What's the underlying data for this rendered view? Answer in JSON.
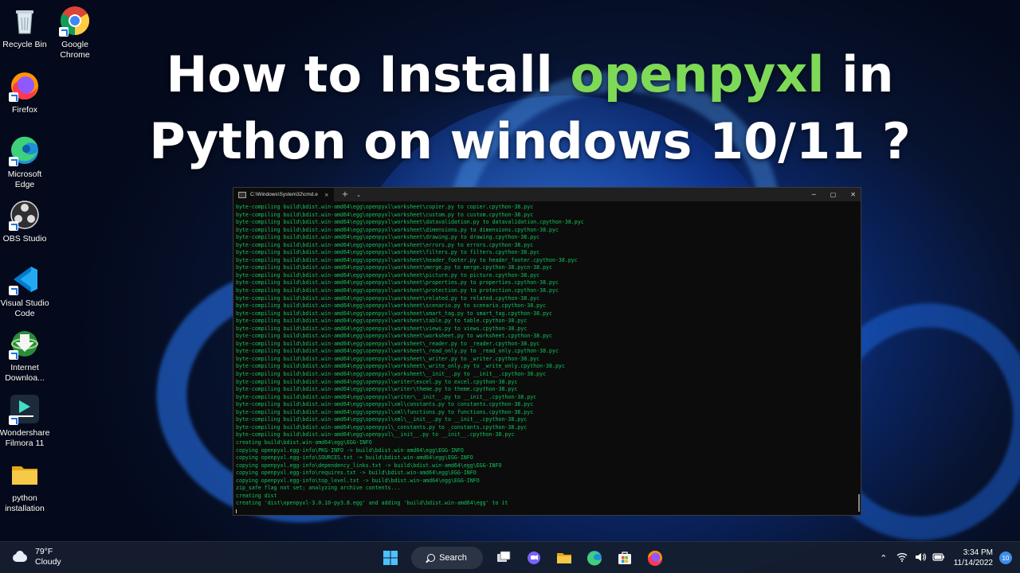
{
  "desktop": {
    "icons": [
      {
        "label": "Recycle Bin",
        "icon": "recycle-bin-icon"
      },
      {
        "label": "Google Chrome",
        "icon": "chrome-icon"
      },
      {
        "label": "Firefox",
        "icon": "firefox-icon"
      },
      {
        "label": "Microsoft Edge",
        "icon": "edge-icon"
      },
      {
        "label": "OBS Studio",
        "icon": "obs-icon"
      },
      {
        "label": "Visual Studio Code",
        "icon": "vscode-icon"
      },
      {
        "label": "Internet Downloa...",
        "icon": "idm-icon"
      },
      {
        "label": "Wondershare Filmora 11",
        "icon": "filmora-icon"
      },
      {
        "label": "python installation",
        "icon": "folder-icon"
      }
    ]
  },
  "headline": {
    "part1": "How to Install ",
    "highlight": "openpyxl",
    "part2": " in",
    "line2": "Python on windows 10/11 ?",
    "highlight_color": "#7ed957"
  },
  "terminal": {
    "tab_title": "C:\\Windows\\System32\\cmd.e",
    "tab_close": "×",
    "new_tab": "+",
    "dropdown": "⌄",
    "minimize": "─",
    "maximize": "▢",
    "close": "✕",
    "text_color": "#13c35a",
    "lines": [
      "byte-compiling build\\bdist.win-amd64\\egg\\openpyxl\\worksheet\\copier.py to copier.cpython-38.pyc",
      "byte-compiling build\\bdist.win-amd64\\egg\\openpyxl\\worksheet\\custom.py to custom.cpython-38.pyc",
      "byte-compiling build\\bdist.win-amd64\\egg\\openpyxl\\worksheet\\datavalidation.py to datavalidation.cpython-38.pyc",
      "byte-compiling build\\bdist.win-amd64\\egg\\openpyxl\\worksheet\\dimensions.py to dimensions.cpython-38.pyc",
      "byte-compiling build\\bdist.win-amd64\\egg\\openpyxl\\worksheet\\drawing.py to drawing.cpython-38.pyc",
      "byte-compiling build\\bdist.win-amd64\\egg\\openpyxl\\worksheet\\errors.py to errors.cpython-38.pyc",
      "byte-compiling build\\bdist.win-amd64\\egg\\openpyxl\\worksheet\\filters.py to filters.cpython-38.pyc",
      "byte-compiling build\\bdist.win-amd64\\egg\\openpyxl\\worksheet\\header_footer.py to header_footer.cpython-38.pyc",
      "byte-compiling build\\bdist.win-amd64\\egg\\openpyxl\\worksheet\\merge.py to merge.cpython-38.pycn-38.pyc",
      "byte-compiling build\\bdist.win-amd64\\egg\\openpyxl\\worksheet\\picture.py to picture.cpython-38.pyc",
      "byte-compiling build\\bdist.win-amd64\\egg\\openpyxl\\worksheet\\properties.py to properties.cpython-38.pyc",
      "byte-compiling build\\bdist.win-amd64\\egg\\openpyxl\\worksheet\\protection.py to protection.cpython-38.pyc",
      "byte-compiling build\\bdist.win-amd64\\egg\\openpyxl\\worksheet\\related.py to related.cpython-38.pyc",
      "byte-compiling build\\bdist.win-amd64\\egg\\openpyxl\\worksheet\\scenario.py to scenario.cpython-38.pyc",
      "byte-compiling build\\bdist.win-amd64\\egg\\openpyxl\\worksheet\\smart_tag.py to smart_tag.cpython-38.pyc",
      "byte-compiling build\\bdist.win-amd64\\egg\\openpyxl\\worksheet\\table.py to table.cpython-38.pyc",
      "byte-compiling build\\bdist.win-amd64\\egg\\openpyxl\\worksheet\\views.py to views.cpython-38.pyc",
      "byte-compiling build\\bdist.win-amd64\\egg\\openpyxl\\worksheet\\worksheet.py to worksheet.cpython-38.pyc",
      "byte-compiling build\\bdist.win-amd64\\egg\\openpyxl\\worksheet\\_reader.py to _reader.cpython-38.pyc",
      "byte-compiling build\\bdist.win-amd64\\egg\\openpyxl\\worksheet\\_read_only.py to _read_only.cpython-38.pyc",
      "byte-compiling build\\bdist.win-amd64\\egg\\openpyxl\\worksheet\\_writer.py to _writer.cpython-38.pyc",
      "byte-compiling build\\bdist.win-amd64\\egg\\openpyxl\\worksheet\\_write_only.py to _write_only.cpython-38.pyc",
      "byte-compiling build\\bdist.win-amd64\\egg\\openpyxl\\worksheet\\__init__.py to __init__.cpython-38.pyc",
      "byte-compiling build\\bdist.win-amd64\\egg\\openpyxl\\writer\\excel.py to excel.cpython-38.pyc",
      "byte-compiling build\\bdist.win-amd64\\egg\\openpyxl\\writer\\theme.py to theme.cpython-38.pyc",
      "byte-compiling build\\bdist.win-amd64\\egg\\openpyxl\\writer\\__init__.py to __init__.cpython-38.pyc",
      "byte-compiling build\\bdist.win-amd64\\egg\\openpyxl\\xml\\constants.py to constants.cpython-38.pyc",
      "byte-compiling build\\bdist.win-amd64\\egg\\openpyxl\\xml\\functions.py to functions.cpython-38.pyc",
      "byte-compiling build\\bdist.win-amd64\\egg\\openpyxl\\xml\\__init__.py to __init__.cpython-38.pyc",
      "byte-compiling build\\bdist.win-amd64\\egg\\openpyxl\\_constants.py to _constants.cpython-38.pyc",
      "byte-compiling build\\bdist.win-amd64\\egg\\openpyxl\\__init__.py to __init__.cpython-38.pyc",
      "creating build\\bdist.win-amd64\\egg\\EGG-INFO",
      "copying openpyxl.egg-info\\PKG-INFO -> build\\bdist.win-amd64\\egg\\EGG-INFO",
      "copying openpyxl.egg-info\\SOURCES.txt -> build\\bdist.win-amd64\\egg\\EGG-INFO",
      "copying openpyxl.egg-info\\dependency_links.txt -> build\\bdist.win-amd64\\egg\\EGG-INFO",
      "copying openpyxl.egg-info\\requires.txt -> build\\bdist.win-amd64\\egg\\EGG-INFO",
      "copying openpyxl.egg-info\\top_level.txt -> build\\bdist.win-amd64\\egg\\EGG-INFO",
      "zip_safe flag not set; analyzing archive contents...",
      "creating dist",
      "creating 'dist\\openpyxl-3.0.10-py3.8.egg' and adding 'build\\bdist.win-amd64\\egg' to it"
    ]
  },
  "taskbar": {
    "weather_temp": "79°F",
    "weather_desc": "Cloudy",
    "search_label": "Search",
    "pinned": [
      "start-icon",
      "task-view-icon",
      "chat-icon",
      "file-explorer-icon",
      "edge-icon",
      "store-icon",
      "firefox-icon"
    ],
    "tray_chevron": "⌃",
    "time": "3:34 PM",
    "date": "11/14/2022",
    "notification_count": "10"
  }
}
